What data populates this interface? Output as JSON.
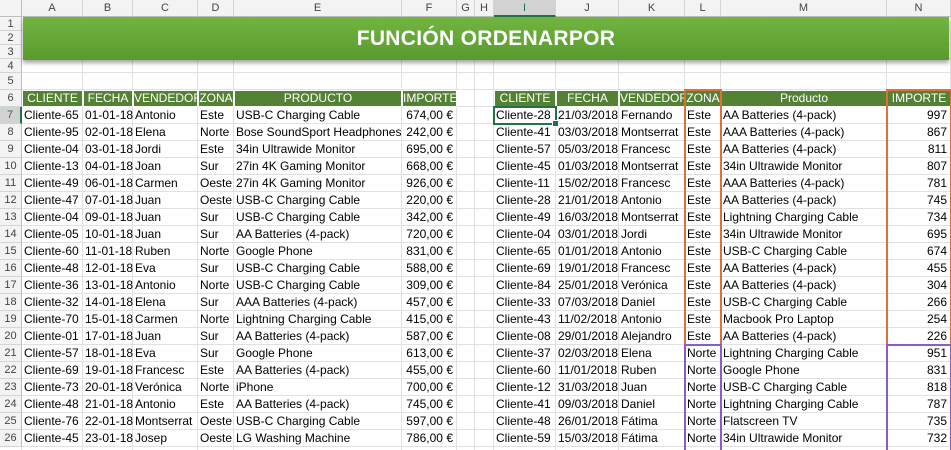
{
  "title": "FUNCIÓN ORDENARPOR",
  "column_letters": [
    "A",
    "B",
    "C",
    "D",
    "E",
    "F",
    "G",
    "H",
    "I",
    "J",
    "K",
    "L",
    "M",
    "N"
  ],
  "row_numbers": [
    "1",
    "2",
    "3",
    "4",
    "5",
    "6",
    "7",
    "8",
    "9",
    "10",
    "11",
    "12",
    "13",
    "14",
    "15",
    "16",
    "17",
    "18",
    "19",
    "20",
    "21",
    "22",
    "23",
    "24",
    "25",
    "26"
  ],
  "selected_column": "I",
  "selected_row": "7",
  "left_table": {
    "headers": [
      "CLIENTE",
      "FECHA",
      "VENDEDOR",
      "ZONA",
      "PRODUCTO",
      "IMPORTE"
    ],
    "rows": [
      [
        "Cliente-65",
        "01-01-18",
        "Antonio",
        "Este",
        "USB-C Charging Cable",
        "674,00 €"
      ],
      [
        "Cliente-95",
        "02-01-18",
        "Elena",
        "Norte",
        "Bose SoundSport Headphones",
        "242,00 €"
      ],
      [
        "Cliente-04",
        "03-01-18",
        "Jordi",
        "Este",
        "34in Ultrawide Monitor",
        "695,00 €"
      ],
      [
        "Cliente-13",
        "04-01-18",
        "Joan",
        "Sur",
        "27in 4K Gaming Monitor",
        "668,00 €"
      ],
      [
        "Cliente-49",
        "06-01-18",
        "Carmen",
        "Oeste",
        "27in 4K Gaming Monitor",
        "926,00 €"
      ],
      [
        "Cliente-47",
        "07-01-18",
        "Juan",
        "Oeste",
        "USB-C Charging Cable",
        "220,00 €"
      ],
      [
        "Cliente-04",
        "09-01-18",
        "Juan",
        "Sur",
        "USB-C Charging Cable",
        "342,00 €"
      ],
      [
        "Cliente-05",
        "10-01-18",
        "Juan",
        "Sur",
        "AA Batteries (4-pack)",
        "720,00 €"
      ],
      [
        "Cliente-60",
        "11-01-18",
        "Ruben",
        "Norte",
        "Google Phone",
        "831,00 €"
      ],
      [
        "Cliente-48",
        "12-01-18",
        "Eva",
        "Sur",
        "USB-C Charging Cable",
        "588,00 €"
      ],
      [
        "Cliente-36",
        "13-01-18",
        "Antonio",
        "Norte",
        "USB-C Charging Cable",
        "309,00 €"
      ],
      [
        "Cliente-32",
        "14-01-18",
        "Elena",
        "Sur",
        "AAA Batteries (4-pack)",
        "457,00 €"
      ],
      [
        "Cliente-70",
        "15-01-18",
        "Carmen",
        "Norte",
        "Lightning Charging Cable",
        "415,00 €"
      ],
      [
        "Cliente-01",
        "17-01-18",
        "Juan",
        "Sur",
        "AA Batteries (4-pack)",
        "587,00 €"
      ],
      [
        "Cliente-57",
        "18-01-18",
        "Eva",
        "Sur",
        "Google Phone",
        "613,00 €"
      ],
      [
        "Cliente-69",
        "19-01-18",
        "Francesc",
        "Este",
        "AA Batteries (4-pack)",
        "455,00 €"
      ],
      [
        "Cliente-73",
        "20-01-18",
        "Verónica",
        "Norte",
        "iPhone",
        "700,00 €"
      ],
      [
        "Cliente-48",
        "21-01-18",
        "Antonio",
        "Este",
        "AA Batteries (4-pack)",
        "745,00 €"
      ],
      [
        "Cliente-76",
        "22-01-18",
        "Montserrat",
        "Oeste",
        "USB-C Charging Cable",
        "597,00 €"
      ],
      [
        "Cliente-45",
        "23-01-18",
        "Josep",
        "Oeste",
        "LG Washing Machine",
        "786,00 €"
      ]
    ]
  },
  "right_table": {
    "headers": [
      "CLIENTE",
      "FECHA",
      "VENDEDOR",
      "ZONA",
      "Producto",
      "IMPORTE"
    ],
    "rows": [
      [
        "Cliente-28",
        "21/03/2018",
        "Fernando",
        "Este",
        "AA Batteries (4-pack)",
        "997"
      ],
      [
        "Cliente-41",
        "03/03/2018",
        "Montserrat",
        "Este",
        "AAA Batteries (4-pack)",
        "867"
      ],
      [
        "Cliente-57",
        "05/03/2018",
        "Francesc",
        "Este",
        "AA Batteries (4-pack)",
        "811"
      ],
      [
        "Cliente-45",
        "01/03/2018",
        "Montserrat",
        "Este",
        "34in Ultrawide Monitor",
        "807"
      ],
      [
        "Cliente-11",
        "15/02/2018",
        "Francesc",
        "Este",
        "AAA Batteries (4-pack)",
        "781"
      ],
      [
        "Cliente-28",
        "21/01/2018",
        "Antonio",
        "Este",
        "AA Batteries (4-pack)",
        "745"
      ],
      [
        "Cliente-49",
        "16/03/2018",
        "Montserrat",
        "Este",
        "Lightning Charging Cable",
        "734"
      ],
      [
        "Cliente-04",
        "03/01/2018",
        "Jordi",
        "Este",
        "34in Ultrawide Monitor",
        "695"
      ],
      [
        "Cliente-65",
        "01/01/2018",
        "Antonio",
        "Este",
        "USB-C Charging Cable",
        "674"
      ],
      [
        "Cliente-69",
        "19/01/2018",
        "Francesc",
        "Este",
        "AA Batteries (4-pack)",
        "455"
      ],
      [
        "Cliente-84",
        "25/01/2018",
        "Verónica",
        "Este",
        "AA Batteries (4-pack)",
        "304"
      ],
      [
        "Cliente-33",
        "07/03/2018",
        "Daniel",
        "Este",
        "USB-C Charging Cable",
        "266"
      ],
      [
        "Cliente-43",
        "11/02/2018",
        "Antonio",
        "Este",
        "Macbook Pro Laptop",
        "254"
      ],
      [
        "Cliente-08",
        "29/01/2018",
        "Alejandro",
        "Este",
        "AA Batteries (4-pack)",
        "226"
      ],
      [
        "Cliente-37",
        "02/03/2018",
        "Elena",
        "Norte",
        "Lightning Charging Cable",
        "951"
      ],
      [
        "Cliente-60",
        "11/01/2018",
        "Ruben",
        "Norte",
        "Google Phone",
        "831"
      ],
      [
        "Cliente-12",
        "31/03/2018",
        "Juan",
        "Norte",
        "USB-C Charging Cable",
        "818"
      ],
      [
        "Cliente-41",
        "09/03/2018",
        "Daniel",
        "Norte",
        "Lightning Charging Cable",
        "787"
      ],
      [
        "Cliente-48",
        "26/01/2018",
        "Fátima",
        "Norte",
        "Flatscreen TV",
        "735"
      ],
      [
        "Cliente-59",
        "15/03/2018",
        "Fátima",
        "Norte",
        "34in Ultrawide Monitor",
        "732"
      ]
    ]
  },
  "colors": {
    "banner": "#5a9a2e",
    "header_fill": "#548235",
    "highlight_este": "#e0703a",
    "highlight_norte": "#8b5cc7",
    "selection": "#217346"
  }
}
